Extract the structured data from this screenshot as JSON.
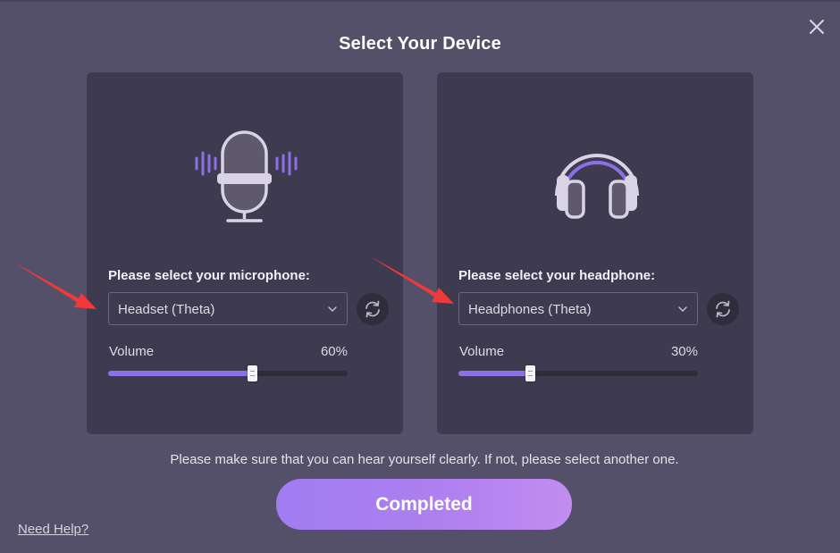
{
  "dialog": {
    "title": "Select Your Device",
    "close_icon": "close-icon"
  },
  "microphone": {
    "illustration_icon": "microphone-icon",
    "label": "Please select your microphone:",
    "selected": "Headset (Theta)",
    "refresh_icon": "refresh-icon",
    "volume_label": "Volume",
    "volume_value": "60%",
    "volume_level": 0.6
  },
  "headphone": {
    "illustration_icon": "headphones-icon",
    "label": "Please select your headphone:",
    "selected": "Headphones (Theta)",
    "refresh_icon": "refresh-icon",
    "volume_label": "Volume",
    "volume_value": "30%",
    "volume_level": 0.3
  },
  "hint": "Please make sure that you can hear yourself clearly. If not, please select another one.",
  "completed_label": "Completed",
  "help_link": "Need Help?",
  "colors": {
    "background": "#545069",
    "panel": "#3e3a4f",
    "accent": "#8c70e6",
    "button_gradient_start": "#9f7df0",
    "button_gradient_end": "#c28df0",
    "annotation_arrow": "#f03a3a"
  }
}
